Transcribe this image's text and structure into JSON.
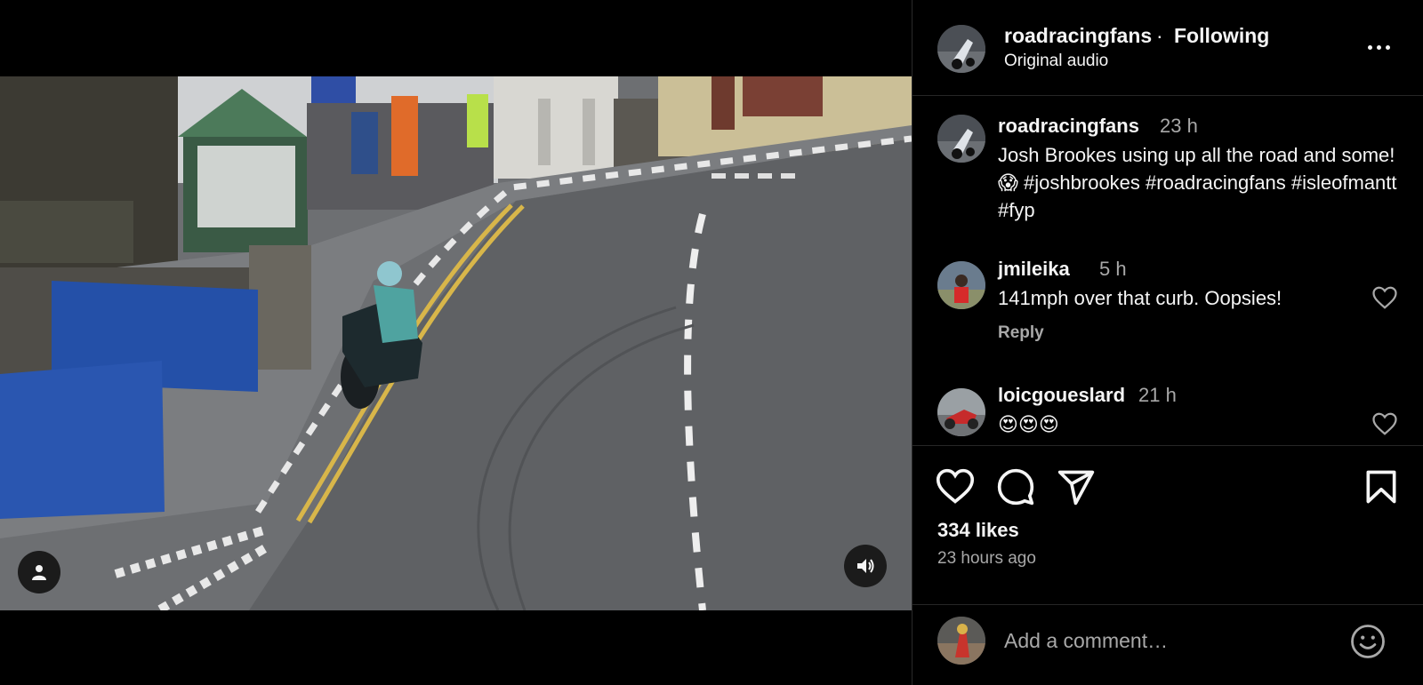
{
  "post": {
    "username": "roadracingfans",
    "separator": "·",
    "follow_status": "Following",
    "audio": "Original audio"
  },
  "caption": {
    "username": "roadracingfans",
    "time": "23 h",
    "text": "Josh Brookes using up all the road and some!😱 #joshbrookes #roadracingfans #isleofmantt #fyp"
  },
  "comments": [
    {
      "username": "jmileika",
      "time": "5 h",
      "text": "141mph over that curb. Oopsies!",
      "reply_label": "Reply"
    },
    {
      "username": "loicgoueslard",
      "time": "21 h",
      "text": "😍😍😍"
    }
  ],
  "actions": {
    "likes": "334 likes",
    "posted_ago": "23 hours ago"
  },
  "comment_box": {
    "placeholder": "Add a comment…"
  },
  "icons": {
    "more": "more-options-icon",
    "like": "heart-icon",
    "comment": "comment-icon",
    "share": "share-icon",
    "save": "bookmark-icon",
    "emoji": "emoji-icon",
    "tags": "user-tag-icon",
    "audio": "speaker-icon"
  },
  "colors": {
    "background": "#000000",
    "text": "#f5f5f5",
    "secondary_text": "#a8a8a8",
    "divider": "#262626"
  }
}
